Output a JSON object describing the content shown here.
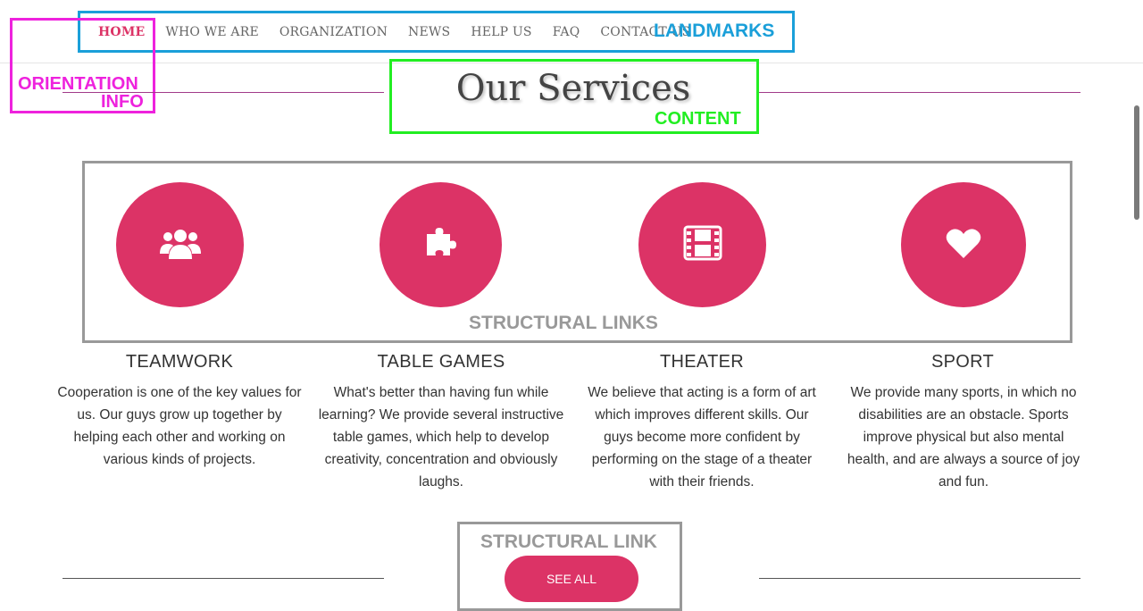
{
  "nav": {
    "items": [
      {
        "label": "HOME",
        "active": true
      },
      {
        "label": "WHO WE ARE"
      },
      {
        "label": "ORGANIZATION"
      },
      {
        "label": "NEWS"
      },
      {
        "label": "HELP US"
      },
      {
        "label": "FAQ"
      },
      {
        "label": "CONTACT US"
      }
    ]
  },
  "annotations": {
    "landmarks": "LANDMARKS",
    "orientation_line1": "ORIENTATION",
    "orientation_line2": "INFO",
    "content": "CONTENT",
    "structural_links": "STRUCTURAL LINKS",
    "structural_link": "STRUCTURAL LINK",
    "colors": {
      "landmarks": "#1a9fd9",
      "orientation": "#ee22dd",
      "content": "#22ee22",
      "structural": "#999999"
    }
  },
  "section": {
    "title": "Our Services"
  },
  "services": [
    {
      "icon": "users-icon",
      "title": "TEAMWORK",
      "text": "Cooperation is one of the key values for us. Our guys grow up together by helping each other and working on various kinds of projects."
    },
    {
      "icon": "puzzle-icon",
      "title": "TABLE GAMES",
      "text": "What's better than having fun while learning? We provide several instructive table games, which help to develop creativity, concentration and obviously laughs."
    },
    {
      "icon": "film-icon",
      "title": "THEATER",
      "text": "We believe that acting is a form of art which improves different skills. Our guys become more confident by performing on the stage of a theater with their friends."
    },
    {
      "icon": "heart-icon",
      "title": "SPORT",
      "text": "We provide many sports, in which no disabilities are an obstacle. Sports improve physical but also mental health, and are always a source of joy and fun."
    }
  ],
  "cta": {
    "see_all": "SEE ALL"
  },
  "colors": {
    "accent": "#dc3366"
  }
}
